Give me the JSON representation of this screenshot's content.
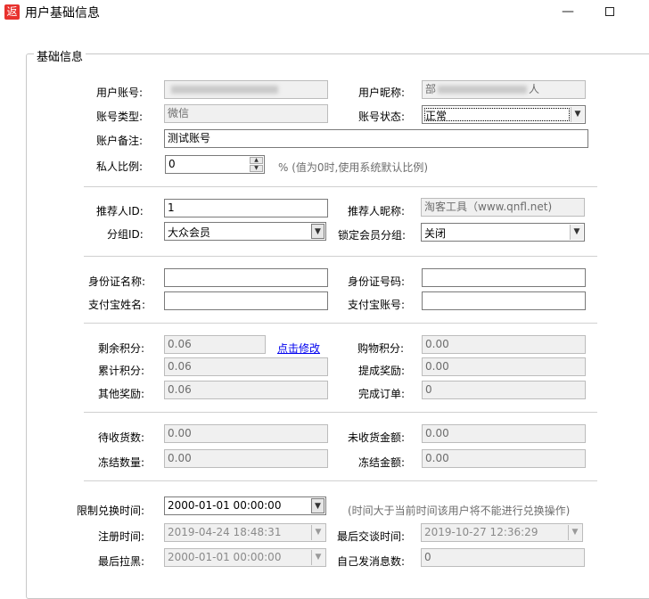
{
  "window": {
    "icon_char": "返",
    "title": "用户基础信息",
    "minimize_glyph": "—"
  },
  "group": {
    "legend": "基础信息"
  },
  "basic": {
    "account_label": "用户账号:",
    "nickname_label": "用户昵称:",
    "nickname_suffix": "人",
    "nickname_prefix": "部",
    "account_type_label": "账号类型:",
    "account_type_value": "微信",
    "account_status_label": "账号状态:",
    "account_status_value": "正常",
    "remark_label": "账户备注:",
    "remark_value": "测试账号",
    "ratio_label": "私人比例:",
    "ratio_value": "0",
    "ratio_hint": "% (值为0时,使用系统默认比例)"
  },
  "referrer": {
    "id_label": "推荐人ID:",
    "id_value": "1",
    "nick_label": "推荐人昵称:",
    "nick_value": "淘客工具（www.qnfl.net)",
    "group_label": "分组ID:",
    "group_value": "大众会员",
    "lock_label": "锁定会员分组:",
    "lock_value": "关闭"
  },
  "identity": {
    "name_label": "身份证名称:",
    "number_label": "身份证号码:",
    "alipay_name_label": "支付宝姓名:",
    "alipay_account_label": "支付宝账号:"
  },
  "points": {
    "remaining_label": "剩余积分:",
    "remaining_value": "0.06",
    "edit_link": "点击修改",
    "shopping_label": "购物积分:",
    "shopping_value": "0.00",
    "cumulative_label": "累计积分:",
    "cumulative_value": "0.06",
    "commission_label": "提成奖励:",
    "commission_value": "0.00",
    "other_label": "其他奖励:",
    "other_value": "0.06",
    "orders_label": "完成订单:",
    "orders_value": "0"
  },
  "goods": {
    "pending_count_label": "待收货数:",
    "pending_count_value": "0.00",
    "pending_amount_label": "未收货金额:",
    "pending_amount_value": "0.00",
    "frozen_count_label": "冻结数量:",
    "frozen_count_value": "0.00",
    "frozen_amount_label": "冻结金额:",
    "frozen_amount_value": "0.00"
  },
  "times": {
    "limit_label": "限制兑换时间:",
    "limit_value": "2000-01-01 00:00:00",
    "limit_hint": "(时间大于当前时间该用户将不能进行兑换操作)",
    "register_label": "注册时间:",
    "register_value": "2019-04-24 18:48:31",
    "last_trade_label": "最后交谈时间:",
    "last_trade_value": "2019-10-27 12:36:29",
    "blacklist_label": "最后拉黑:",
    "blacklist_value": "2000-01-01 00:00:00",
    "self_msg_label": "自己发消息数:",
    "self_msg_value": "0"
  },
  "glyphs": {
    "dropdown": "▼",
    "spin_up": "▲",
    "spin_down": "▼"
  }
}
